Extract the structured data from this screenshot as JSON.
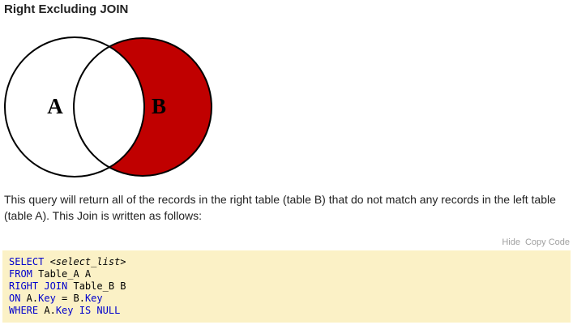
{
  "title": "Right Excluding JOIN",
  "venn": {
    "label_a": "A",
    "label_b": "B",
    "highlight_color": "#c00000"
  },
  "description": "This query will return all of the records in the right table (table B) that do not match any records in the left table (table A). This Join is written as follows:",
  "code_toolbar": {
    "hide_label": "Hide",
    "copy_label": "Copy Code"
  },
  "code": {
    "line1": {
      "kw1": "SELECT",
      "rest": " <select_list>"
    },
    "line2": {
      "kw1": "FROM",
      "rest": " Table_A A"
    },
    "line3": {
      "kw1": "RIGHT JOIN",
      "rest": " Table_B B"
    },
    "line4": {
      "kw1": "ON",
      "t1": " A.",
      "kw2": "Key",
      "t2": " = B.",
      "kw3": "Key"
    },
    "line5": {
      "kw1": "WHERE",
      "t1": " A.",
      "kw2": "Key",
      "t2": " ",
      "kw3": "IS NULL"
    }
  }
}
